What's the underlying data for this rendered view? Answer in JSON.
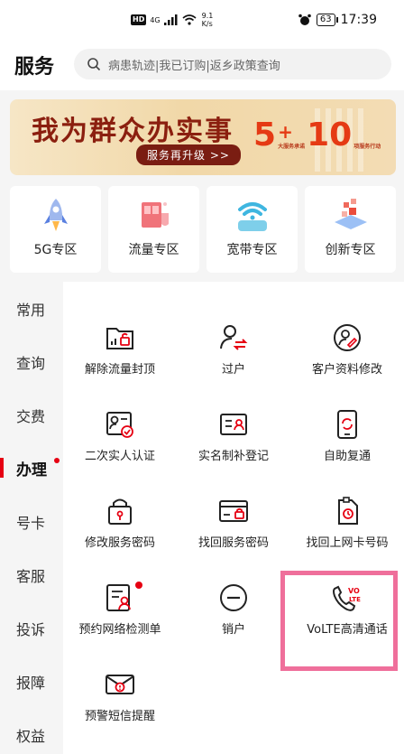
{
  "status": {
    "hd": "HD",
    "net": "4G",
    "speed_value": "9.1",
    "speed_unit": "K/s",
    "battery": "63",
    "time": "17:39"
  },
  "header": {
    "title": "服务",
    "search_placeholder": "病患轨迹|我已订购|返乡政策查询"
  },
  "banner": {
    "main_text": "我为群众办实事",
    "pill_text": "服务再升级 >>",
    "num_a": "5",
    "plus": "+",
    "num_b": "10",
    "small_a": "大服务承诺",
    "small_b": "项服务行动"
  },
  "zones": [
    {
      "label": "5G专区",
      "icon": "rocket-icon"
    },
    {
      "label": "流量专区",
      "icon": "data-package-icon"
    },
    {
      "label": "宽带专区",
      "icon": "wifi-icon"
    },
    {
      "label": "创新专区",
      "icon": "innovation-cubes-icon"
    }
  ],
  "nav": [
    "常用",
    "查询",
    "交费",
    "办理",
    "号卡",
    "客服",
    "投诉",
    "报障",
    "权益"
  ],
  "nav_active": "办理",
  "services": [
    {
      "label": "解除流量封顶",
      "icon": "unlock-traffic-icon"
    },
    {
      "label": "过户",
      "icon": "transfer-user-icon"
    },
    {
      "label": "客户资料修改",
      "icon": "edit-profile-icon"
    },
    {
      "label": "二次实人认证",
      "icon": "id-verify-icon"
    },
    {
      "label": "实名制补登记",
      "icon": "realname-register-icon"
    },
    {
      "label": "自助复通",
      "icon": "phone-restore-icon"
    },
    {
      "label": "修改服务密码",
      "icon": "lock-password-icon"
    },
    {
      "label": "找回服务密码",
      "icon": "card-lock-icon"
    },
    {
      "label": "找回上网卡号码",
      "icon": "sim-card-icon"
    },
    {
      "label": "预约网络检测单",
      "icon": "network-check-form-icon"
    },
    {
      "label": "销户",
      "icon": "cancel-account-icon"
    },
    {
      "label": "VoLTE高清通话",
      "icon": "volte-phone-icon"
    },
    {
      "label": "预警短信提醒",
      "icon": "sms-alert-icon"
    }
  ],
  "colors": {
    "accent": "#e60012",
    "highlight": "#ef6f9b",
    "icon_stroke": "#222222"
  }
}
